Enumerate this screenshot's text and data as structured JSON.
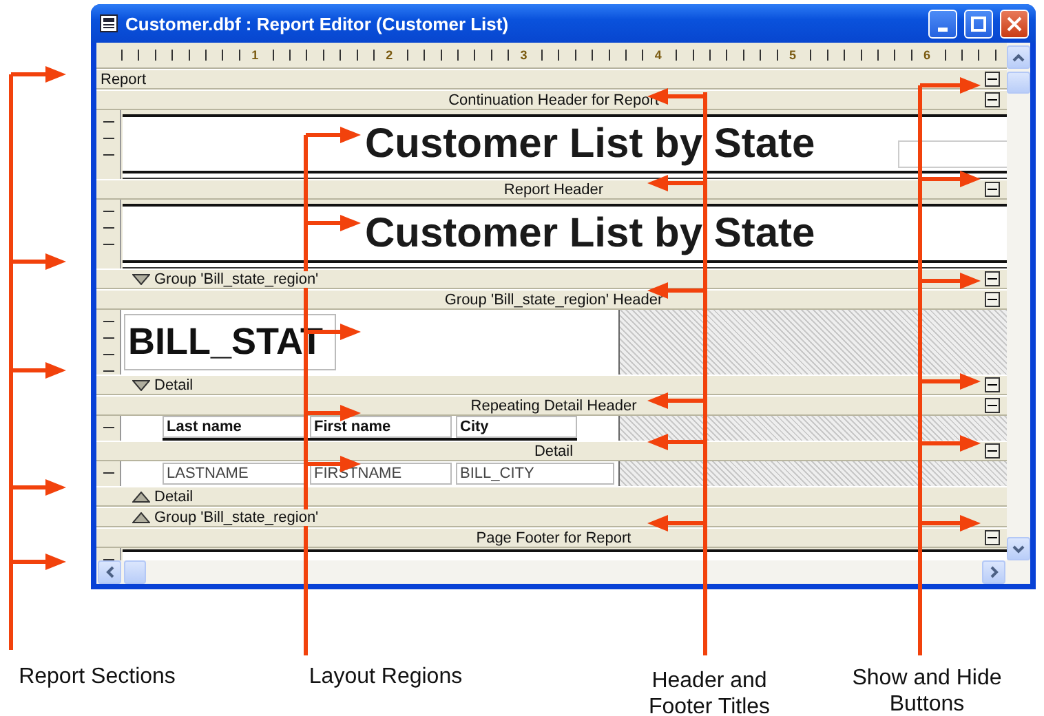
{
  "window": {
    "title": "Customer.dbf : Report Editor (Customer List)"
  },
  "ruler": {
    "numbers": [
      "1",
      "2",
      "3",
      "4",
      "5",
      "6"
    ]
  },
  "sections": [
    {
      "kind": "section_band",
      "label": "Report",
      "expanded": true
    },
    {
      "kind": "title_band",
      "label": "Continuation Header for Report",
      "expanded": true
    },
    {
      "kind": "title",
      "text": "Customer List by State",
      "side_field": true
    },
    {
      "kind": "title_band",
      "label": "Report Header",
      "expanded": true
    },
    {
      "kind": "title",
      "text": "Customer List by State",
      "side_field": false
    },
    {
      "kind": "group_open",
      "label": "Group 'Bill_state_region'",
      "expanded": true
    },
    {
      "kind": "title_band",
      "label": "Group 'Bill_state_region' Header",
      "expanded": true
    },
    {
      "kind": "field",
      "text": "BILL_STAT"
    },
    {
      "kind": "group_open",
      "label": "Detail",
      "expanded": true
    },
    {
      "kind": "title_band",
      "label": "Repeating Detail Header",
      "expanded": true
    },
    {
      "kind": "columns",
      "cells": [
        "Last name",
        "First name",
        "City"
      ]
    },
    {
      "kind": "title_band",
      "label": "Detail",
      "expanded": true
    },
    {
      "kind": "fields",
      "cells": [
        "LASTNAME",
        "FIRSTNAME",
        "BILL_CITY"
      ]
    },
    {
      "kind": "group_close",
      "label": "Detail"
    },
    {
      "kind": "group_close",
      "label": "Group 'Bill_state_region'"
    },
    {
      "kind": "title_band",
      "label": "Page Footer for Report",
      "expanded": true
    },
    {
      "kind": "blank"
    }
  ],
  "callouts": [
    {
      "lines": [
        "Report Sections"
      ]
    },
    {
      "lines": [
        "Layout Regions"
      ]
    },
    {
      "lines": [
        "Header and",
        "Footer Titles"
      ]
    },
    {
      "lines": [
        "Show and Hide",
        "Buttons"
      ]
    }
  ]
}
